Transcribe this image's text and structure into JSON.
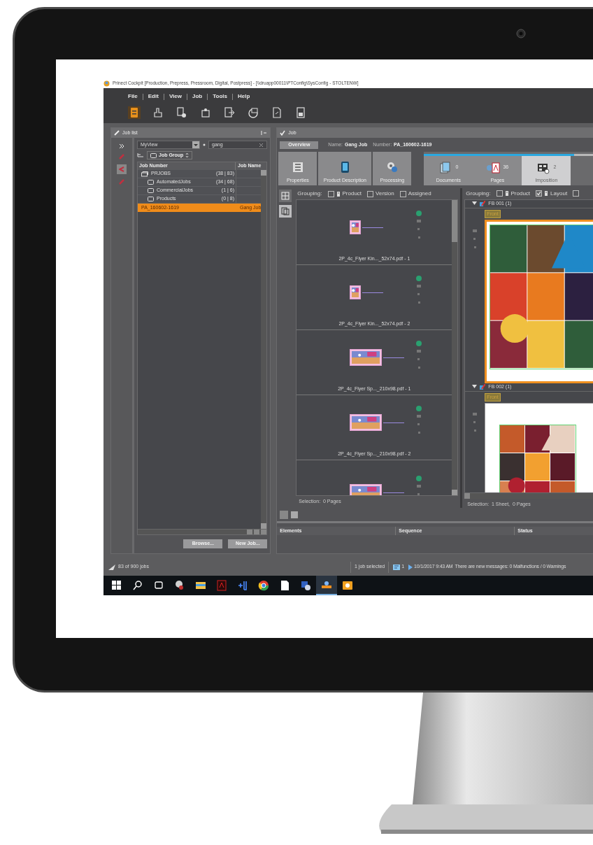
{
  "window": {
    "title": "Prinect Cockpit [Production, Prepress, Pressroom, Digital, Postpress] - [\\\\druapp00011\\PTConfig\\SysConfig - STOLTENW]"
  },
  "menu": [
    "File",
    "Edit",
    "View",
    "Job",
    "Tools",
    "Help"
  ],
  "toolbar": [
    {
      "kind": "jobs",
      "selected": true
    },
    {
      "kind": "hand",
      "selected": false
    },
    {
      "kind": "doc-gear",
      "selected": false
    },
    {
      "kind": "puzzle",
      "selected": false
    },
    {
      "kind": "export",
      "selected": false
    },
    {
      "kind": "print",
      "selected": false
    },
    {
      "kind": "pdf",
      "selected": false
    },
    {
      "kind": "archive",
      "selected": false
    }
  ],
  "job_list": {
    "title": "Job list",
    "view": "MyView",
    "search": "gang",
    "group": "Job Group",
    "columns": [
      "Job Number",
      "Job Name"
    ],
    "rows": [
      {
        "kind": "group",
        "number": "PRJOBS",
        "count": "(38 | 83)",
        "selected": false,
        "children": [
          {
            "kind": "folder",
            "number": "AutomatedJobs",
            "count": "(34 | 68)",
            "selected": false
          },
          {
            "kind": "folder",
            "number": "CommercialJobs",
            "count": "(1 | 6)",
            "selected": false
          },
          {
            "kind": "folder",
            "number": "Products",
            "count": "(0 | 8)",
            "selected": false
          }
        ]
      },
      {
        "kind": "job",
        "number": "PA_160602-1619",
        "name": "Gang Job",
        "selected": true
      }
    ],
    "buttons": [
      "Browse...",
      "New Job..."
    ]
  },
  "job": {
    "title": "Job",
    "tab": "Overview",
    "name_label": "Name:",
    "name": "Gang Job",
    "number_label": "Number:",
    "number": "PA_160602-1619",
    "tools": [
      {
        "kind": "properties",
        "label": "Properties"
      },
      {
        "kind": "product",
        "label": "Product Description"
      },
      {
        "kind": "processing",
        "label": "Processing"
      }
    ],
    "progress": {
      "level": 0.82
    },
    "steps": [
      {
        "kind": "documents",
        "label": "Documents",
        "count": "0",
        "selected": false
      },
      {
        "kind": "pages",
        "label": "Pages",
        "count": "36",
        "selected": false
      },
      {
        "kind": "imposition",
        "label": "Imposition",
        "count": "2",
        "selected": true
      }
    ],
    "pages": {
      "grouping": "Grouping:",
      "options": [
        {
          "kind": "icon",
          "label": "Product",
          "checked": false
        },
        {
          "kind": "bare",
          "label": "Version",
          "checked": false
        },
        {
          "kind": "bare",
          "label": "Assigned",
          "checked": false
        }
      ],
      "items": [
        {
          "kind": "portrait",
          "caption": "2P_4c_Flyer Kin..._52x74.pdf - 1"
        },
        {
          "kind": "portrait",
          "caption": "2P_4c_Flyer Kin..._52x74.pdf - 2"
        },
        {
          "kind": "landscape",
          "caption": "2P_4c_Flyer Sp..._210x98.pdf - 1"
        },
        {
          "kind": "landscape",
          "caption": "2P_4c_Flyer Sp..._210x98.pdf - 2"
        },
        {
          "kind": "landscape"
        }
      ],
      "selection": "Selection:  0 Pages"
    },
    "sheets": {
      "grouping": "Grouping:",
      "options": [
        {
          "kind": "icon",
          "label": "Product",
          "checked": false
        },
        {
          "kind": "icon",
          "label": "Layout",
          "checked": true
        },
        {
          "kind": "bare",
          "checked": false
        }
      ],
      "items": [
        {
          "label": "FB 001 (1)",
          "side": "Front",
          "selected": true
        },
        {
          "label": "FB 002 (1)",
          "side": "Front",
          "selected": false
        }
      ],
      "selection": "Selection:  1 Sheet,  0 Pages"
    },
    "table": {
      "columns": [
        "Elements",
        "Sequence",
        "Status"
      ]
    }
  },
  "status_bar": {
    "jobs": "83 of 900 jobs",
    "selection": "1 job selected",
    "message_count": "1",
    "time": "10/1/2017 9:43 AM",
    "message": "There are new messages: 0 Malfunctions / 0 Warnings"
  },
  "taskbar": [
    {
      "kind": "start",
      "selected": false
    },
    {
      "kind": "search",
      "selected": false
    },
    {
      "kind": "taskview",
      "selected": false
    },
    {
      "kind": "tool",
      "selected": false
    },
    {
      "kind": "files",
      "selected": false
    },
    {
      "kind": "pdf",
      "selected": false
    },
    {
      "kind": "hj",
      "selected": false
    },
    {
      "kind": "browser",
      "selected": false
    },
    {
      "kind": "document",
      "selected": false
    },
    {
      "kind": "network",
      "selected": false
    },
    {
      "kind": "cockpit",
      "selected": true
    },
    {
      "kind": "mail",
      "selected": false
    }
  ]
}
